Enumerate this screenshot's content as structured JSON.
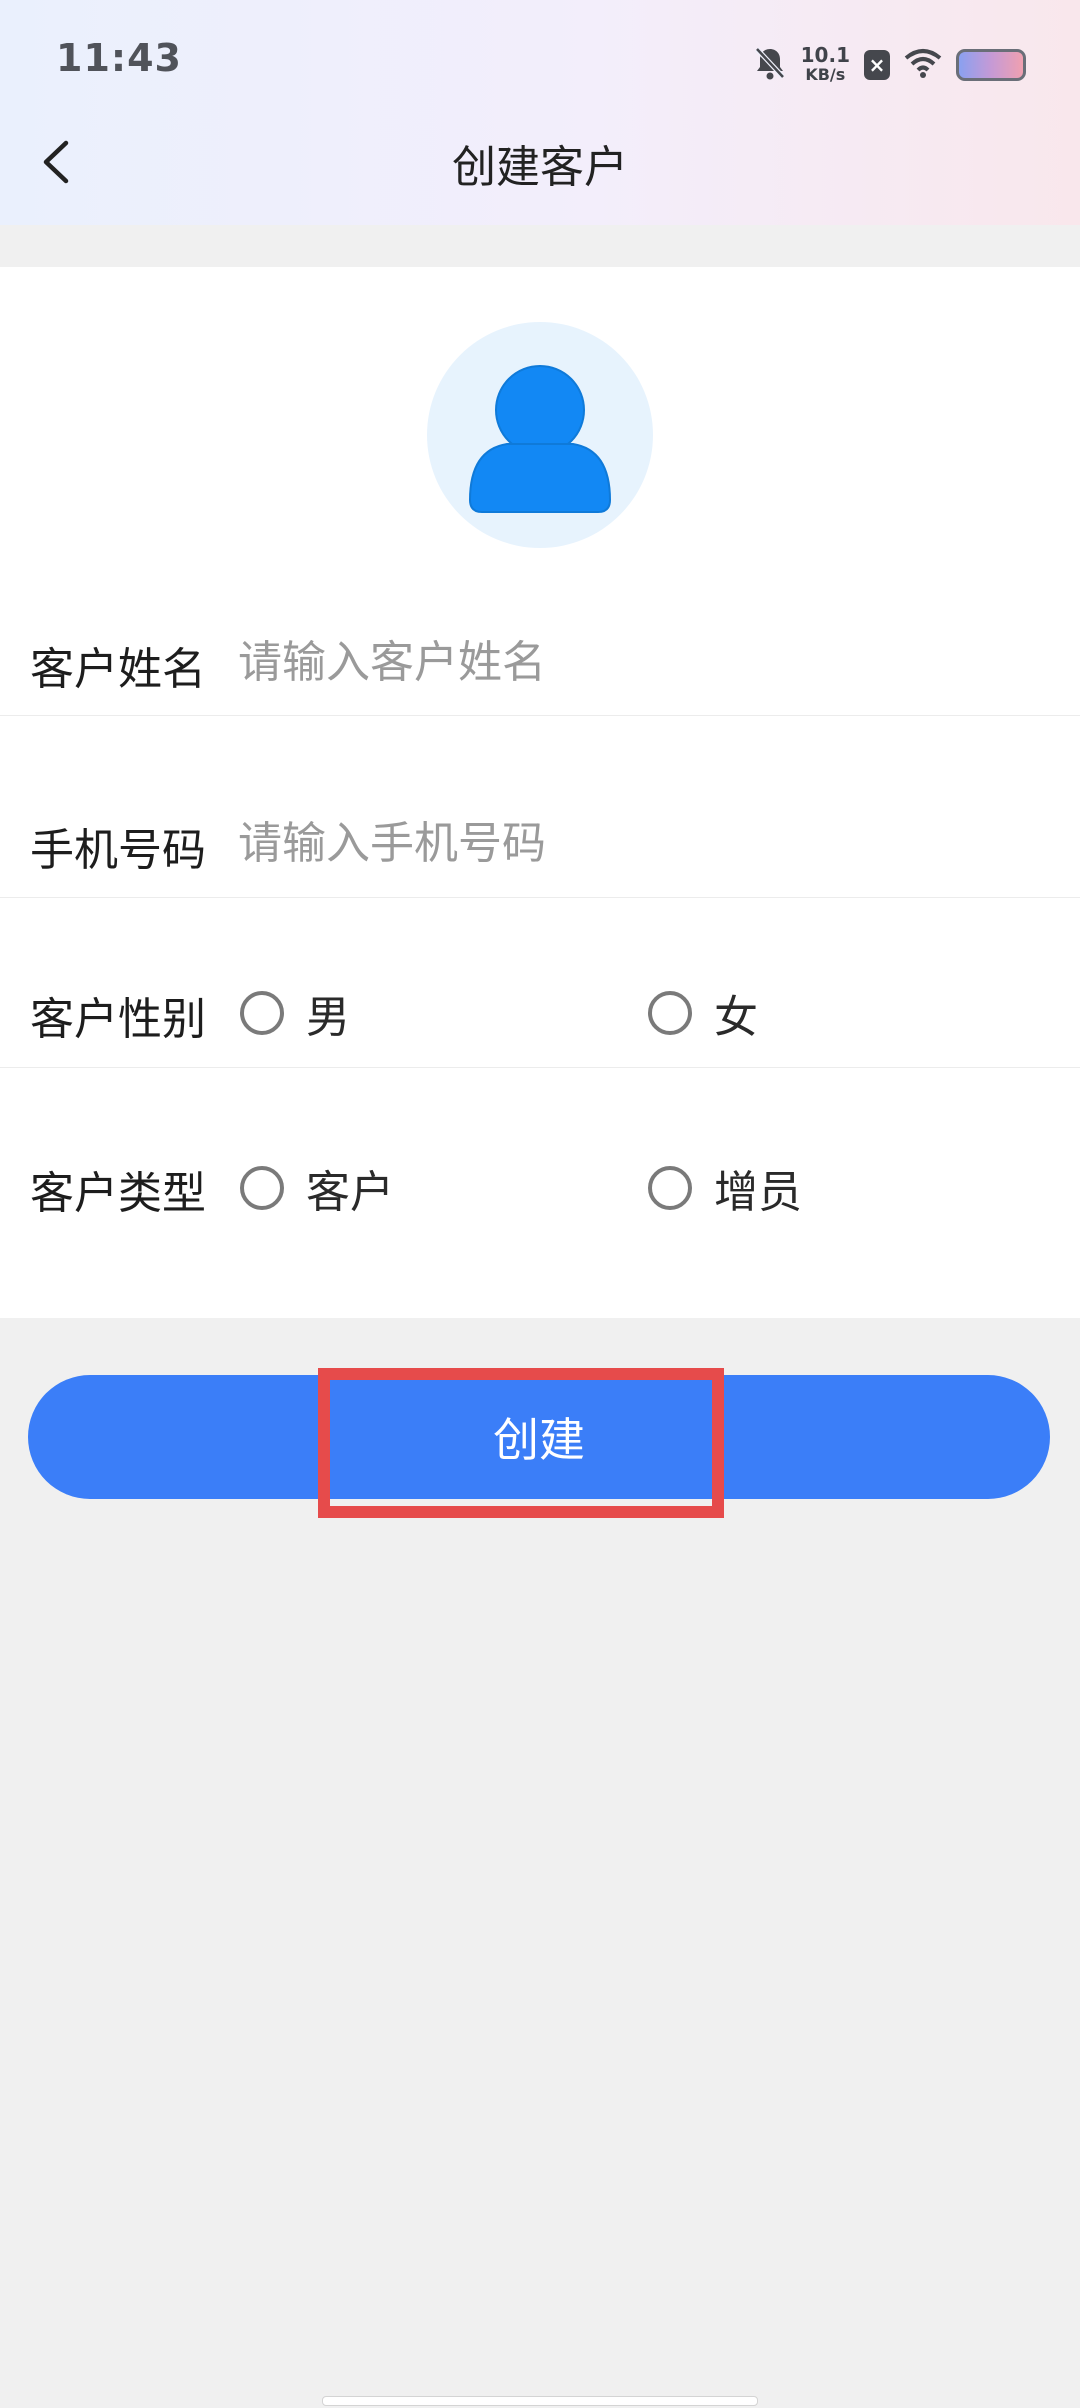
{
  "status_bar": {
    "time": "11:43",
    "net_speed_value": "10.1",
    "net_speed_unit": "KB/s",
    "icons": [
      "bell-muted-icon",
      "close-badge-icon",
      "wifi-icon",
      "battery-icon"
    ]
  },
  "header": {
    "title": "创建客户",
    "back_icon": "chevron-left-icon"
  },
  "avatar": {
    "icon": "user-avatar-icon",
    "accent": "#1288f4",
    "background": "#e7f3fd"
  },
  "form": {
    "name": {
      "label": "客户姓名",
      "placeholder": "请输入客户姓名",
      "value": ""
    },
    "phone": {
      "label": "手机号码",
      "placeholder": "请输入手机号码",
      "value": ""
    },
    "gender": {
      "label": "客户性别",
      "options": [
        "男",
        "女"
      ],
      "selected": null
    },
    "type": {
      "label": "客户类型",
      "options": [
        "客户",
        "增员"
      ],
      "selected": null
    }
  },
  "actions": {
    "create_label": "创建",
    "accent": "#3b7ef8",
    "highlight_color": "#e64b4b"
  }
}
